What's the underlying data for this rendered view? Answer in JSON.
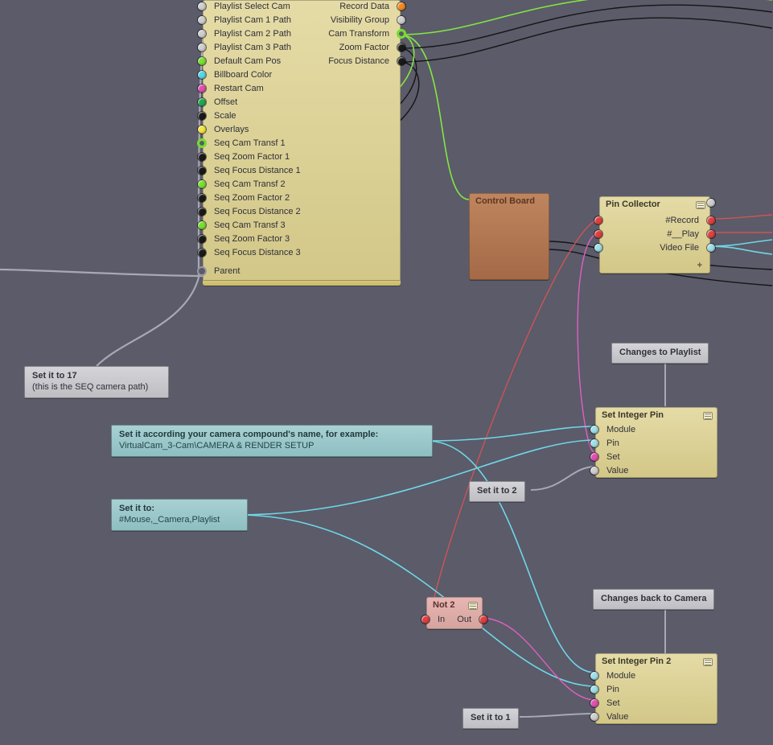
{
  "main_node": {
    "inputs": [
      {
        "label": "Playlist Select Cam",
        "color": "gray"
      },
      {
        "label": "Playlist Cam 1 Path",
        "color": "gray"
      },
      {
        "label": "Playlist Cam 2 Path",
        "color": "gray"
      },
      {
        "label": "Playlist Cam 3 Path",
        "color": "gray"
      },
      {
        "label": "Default Cam Pos",
        "color": "lime"
      },
      {
        "label": "Billboard Color",
        "color": "cyan"
      },
      {
        "label": "Restart Cam",
        "color": "magenta"
      },
      {
        "label": "Offset",
        "color": "green"
      },
      {
        "label": "Scale",
        "color": "black"
      },
      {
        "label": "Overlays",
        "color": "yellow"
      },
      {
        "label": "Seq Cam Transf 1",
        "color": "ring-lime"
      },
      {
        "label": "Seq Zoom Factor 1",
        "color": "black"
      },
      {
        "label": "Seq Focus Distance 1",
        "color": "black"
      },
      {
        "label": "Seq Cam Transf 2",
        "color": "lime"
      },
      {
        "label": "Seq Zoom Factor 2",
        "color": "black"
      },
      {
        "label": "Seq Focus Distance 2",
        "color": "black"
      },
      {
        "label": "Seq Cam Transf 3",
        "color": "lime"
      },
      {
        "label": "Seq Zoom Factor 3",
        "color": "black"
      },
      {
        "label": "Seq Focus Distance 3",
        "color": "black"
      },
      {
        "_spacer": true
      },
      {
        "label": "Parent",
        "color": "dimcircle"
      }
    ],
    "outputs": [
      {
        "label": "Record Data",
        "color": "orange"
      },
      {
        "label": "Visibility Group",
        "color": "gray"
      },
      {
        "label": "Cam Transform",
        "color": "ring-lime"
      },
      {
        "label": "Zoom Factor",
        "color": "black"
      },
      {
        "label": "Focus Distance",
        "color": "black"
      }
    ]
  },
  "control_board": {
    "title": "Control Board"
  },
  "pin_collector": {
    "title": "Pin Collector",
    "pins": [
      {
        "label": "#Record",
        "l": "red",
        "r": "red"
      },
      {
        "label": "#__Play",
        "l": "red",
        "r": "red"
      },
      {
        "label": "Video File",
        "l": "skyblue",
        "r": "skyblue"
      }
    ],
    "plus": "+"
  },
  "set_int_1": {
    "title": "Set Integer Pin",
    "pins": [
      {
        "label": "Module",
        "color": "skyblue"
      },
      {
        "label": "Pin",
        "color": "skyblue"
      },
      {
        "label": "Set",
        "color": "magenta"
      },
      {
        "label": "Value",
        "color": "gray"
      }
    ]
  },
  "set_int_2": {
    "title": "Set Integer Pin 2",
    "pins": [
      {
        "label": "Module",
        "color": "skyblue"
      },
      {
        "label": "Pin",
        "color": "skyblue"
      },
      {
        "label": "Set",
        "color": "magenta"
      },
      {
        "label": "Value",
        "color": "gray"
      }
    ]
  },
  "not2": {
    "title": "Not 2",
    "in": "In",
    "out": "Out"
  },
  "comments": {
    "c17": {
      "t": "Set it to 17",
      "s": "(this is the SEQ camera path)"
    },
    "ccam": {
      "t": "Set it according your camera compound's name, for example:",
      "s": "VirtualCam_3-Cam\\CAMERA & RENDER SETUP"
    },
    "cmouse": {
      "t": "Set it to:",
      "s": "#Mouse,_Camera,Playlist"
    },
    "cto2": {
      "t": "Set it to 2"
    },
    "cto1": {
      "t": "Set it to 1"
    },
    "cplaylist": {
      "t": "Changes to Playlist"
    },
    "ccamera": {
      "t": "Changes back to Camera"
    }
  }
}
